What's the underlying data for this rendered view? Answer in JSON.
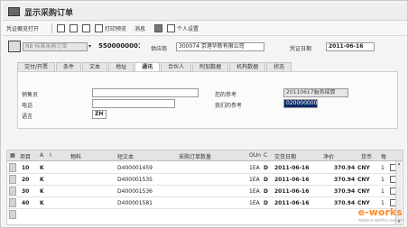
{
  "title": "显示采购订单",
  "toolbar": {
    "doc_overview": "凭证概览打开",
    "print_preview": "打印预览",
    "messages": "消息",
    "personal_settings": "个人设置"
  },
  "header": {
    "doc_type": "NB 标准采购订单",
    "po_number": "5500000001",
    "vendor_label": "供应商",
    "vendor_value": "300074 京港华新有限公司",
    "doc_date_label": "凭证日期",
    "doc_date_value": "2011-06-16"
  },
  "tabs": [
    "交付/开票",
    "条件",
    "文本",
    "地址",
    "通讯",
    "合伙人",
    "附加数据",
    "机构数据",
    "状态"
  ],
  "comm": {
    "salesperson_label": "销售员",
    "salesperson_value": "",
    "phone_label": "电话",
    "phone_value": "",
    "language_label": "语言",
    "language_value": "ZH",
    "your_ref_label": "您的参考",
    "your_ref_value": "20110617服务结算",
    "our_ref_label": "我们的参考",
    "our_ref_value": "0200000002"
  },
  "items": {
    "columns": [
      "项目",
      "A",
      "I",
      "物料",
      "短文本",
      "采购订单数量",
      "OUn",
      "C",
      "交货日期",
      "净价",
      "货币",
      "每"
    ],
    "rows": [
      {
        "item": "10",
        "acct": "K",
        "short_text": "D400001459",
        "oun": "1EA",
        "cat": "D",
        "date": "2011-06-16",
        "price": "370.94",
        "currency": "CNY",
        "per": "1"
      },
      {
        "item": "20",
        "acct": "K",
        "short_text": "D400001535",
        "oun": "1EA",
        "cat": "D",
        "date": "2011-06-16",
        "price": "370.94",
        "currency": "CNY",
        "per": "1"
      },
      {
        "item": "30",
        "acct": "K",
        "short_text": "D400001536",
        "oun": "1EA",
        "cat": "D",
        "date": "2011-06-16",
        "price": "370.94",
        "currency": "CNY",
        "per": "1"
      },
      {
        "item": "40",
        "acct": "K",
        "short_text": "D400001581",
        "oun": "1EA",
        "cat": "D",
        "date": "2011-06-16",
        "price": "370.94",
        "currency": "CNY",
        "per": "1"
      }
    ]
  },
  "watermark": {
    "brand": "e-works",
    "sub": "www.e-works.net.cn"
  },
  "colors": {
    "accent": "#ff7a00",
    "selection": "#0b2a66"
  }
}
